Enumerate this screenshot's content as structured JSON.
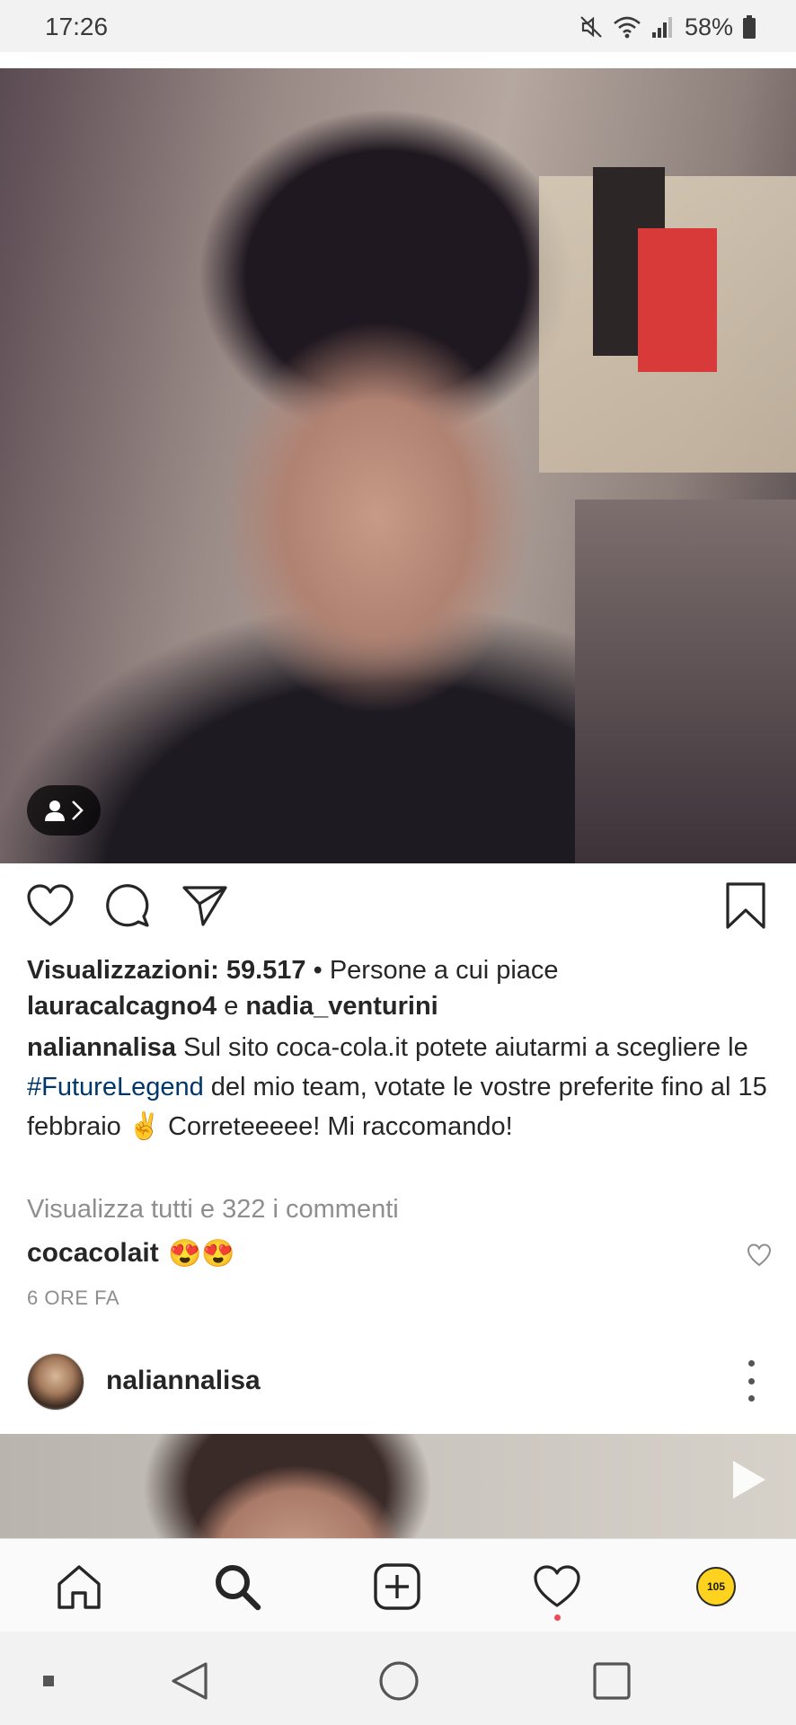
{
  "status_bar": {
    "time": "17:26",
    "battery": "58%",
    "icons": [
      "mute-icon",
      "wifi-icon",
      "signal-icon",
      "battery-icon"
    ]
  },
  "post": {
    "tag_badge_icons": [
      "person-icon",
      "chevron-right-icon"
    ],
    "actions": [
      "heart-icon",
      "comment-icon",
      "share-icon",
      "bookmark-icon"
    ],
    "views_label": "Visualizzazioni: 59.517",
    "likes_prefix": " • Persone a cui piace ",
    "liker_1": "lauracalcagno4",
    "likes_conjunction": " e ",
    "liker_2": "nadia_venturini",
    "caption": {
      "username": "naliannalisa",
      "text_before_hashtag": " Sul sito coca-cola.it potete aiutarmi a scegliere le ",
      "hashtag": "#FutureLegend",
      "text_after_hashtag": " del mio team, votate le vostre preferite fino al 15 febbraio ✌️ Correteeeee! Mi raccomando!"
    },
    "view_all_comments": "Visualizza tutti e 322 i commenti",
    "top_comment": {
      "username": "cocacolait",
      "text": "😍😍"
    },
    "timestamp": "6 ORE FA"
  },
  "next_post": {
    "username": "naliannalisa"
  },
  "bottom_nav": {
    "items": [
      "home-icon",
      "search-icon",
      "new-post-icon",
      "activity-heart-icon",
      "profile-avatar"
    ],
    "profile_avatar_text": "105"
  },
  "system_nav": {
    "items": [
      "recent-dot",
      "back-button",
      "home-button",
      "overview-button"
    ]
  },
  "colors": {
    "text": "#262626",
    "muted": "#8e8e8e",
    "hashtag": "#00376b",
    "notification_dot": "#ed4956"
  }
}
